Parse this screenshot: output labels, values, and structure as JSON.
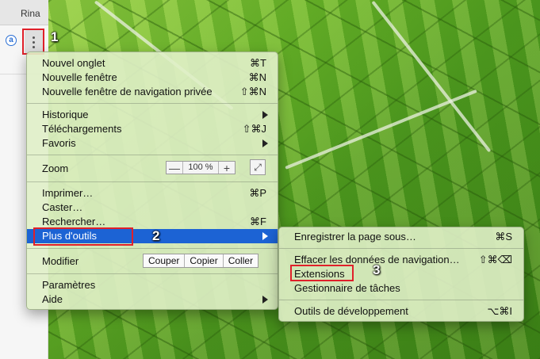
{
  "tab": {
    "label": "Rina"
  },
  "toolbar": {
    "extension_icon": "a"
  },
  "annotations": {
    "step1": "1",
    "step2": "2",
    "step3": "3",
    "highlight_color": "#e0202a"
  },
  "menu": {
    "new_tab": {
      "label": "Nouvel onglet",
      "shortcut": "⌘T"
    },
    "new_window": {
      "label": "Nouvelle fenêtre",
      "shortcut": "⌘N"
    },
    "new_private_window": {
      "label": "Nouvelle fenêtre de navigation privée",
      "shortcut": "⇧⌘N"
    },
    "history": {
      "label": "Historique"
    },
    "downloads": {
      "label": "Téléchargements",
      "shortcut": "⇧⌘J"
    },
    "bookmarks": {
      "label": "Favoris"
    },
    "zoom": {
      "label": "Zoom",
      "minus": "—",
      "value": "100 %",
      "plus": "+",
      "fullscreen": "⤢"
    },
    "print": {
      "label": "Imprimer…",
      "shortcut": "⌘P"
    },
    "cast": {
      "label": "Caster…"
    },
    "find": {
      "label": "Rechercher…",
      "shortcut": "⌘F"
    },
    "more_tools": {
      "label": "Plus d'outils"
    },
    "edit": {
      "label": "Modifier",
      "cut": "Couper",
      "copy": "Copier",
      "paste": "Coller"
    },
    "settings": {
      "label": "Paramètres"
    },
    "help": {
      "label": "Aide"
    }
  },
  "submenu": {
    "save_page": {
      "label": "Enregistrer la page sous…",
      "shortcut": "⌘S"
    },
    "clear_data": {
      "label": "Effacer les données de navigation…",
      "shortcut": "⇧⌘⌫"
    },
    "extensions": {
      "label": "Extensions"
    },
    "task_manager": {
      "label": "Gestionnaire de tâches"
    },
    "dev_tools": {
      "label": "Outils de développement",
      "shortcut": "⌥⌘I"
    }
  },
  "colors": {
    "selection": "#1c63d4",
    "menu_bg": "#e0f0c8"
  }
}
